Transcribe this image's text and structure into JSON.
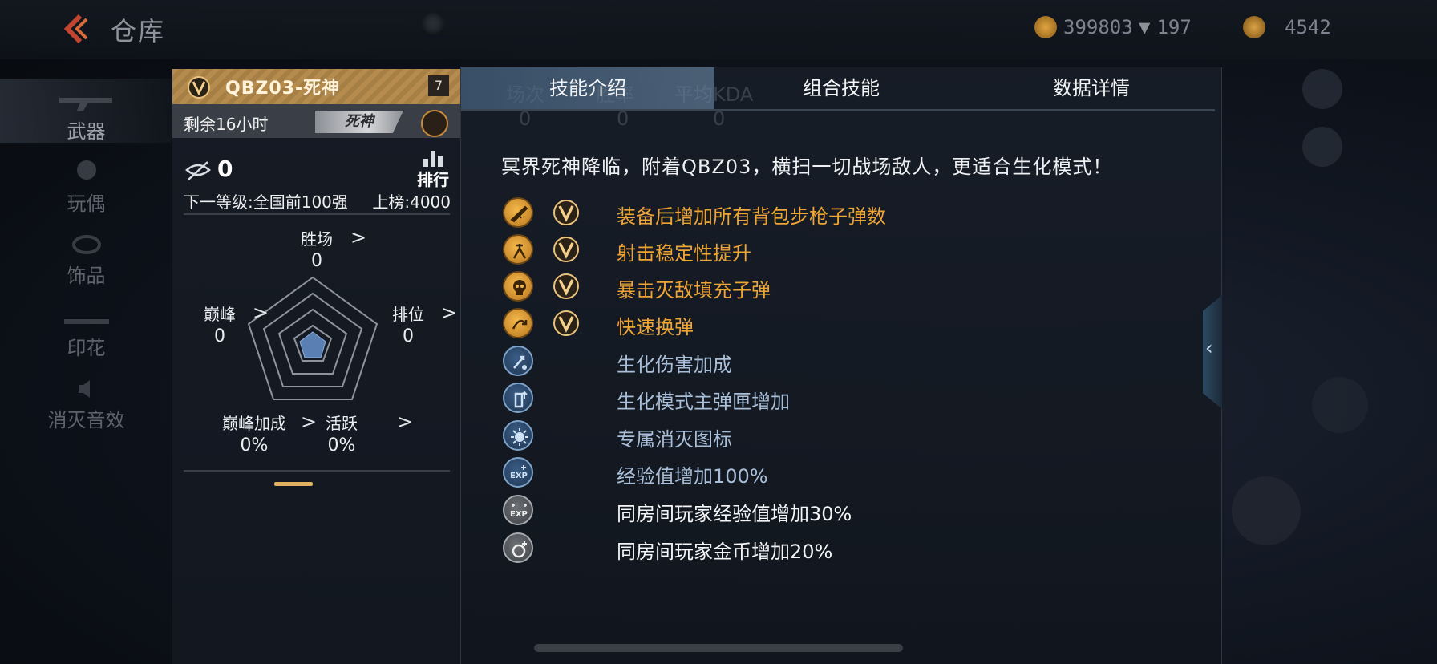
{
  "header": {
    "title": "仓库",
    "currencies": [
      {
        "icon": "gold-coin-icon",
        "value": "399803",
        "color": "#c58a2a"
      },
      {
        "icon": "diamond-icon",
        "value": "197",
        "color": "#8c8f95"
      },
      {
        "icon": "token-icon",
        "value": "4542",
        "color": "#b8862f"
      }
    ]
  },
  "sidebar": {
    "items": [
      {
        "label": "武器",
        "active": true
      },
      {
        "label": "玩偶",
        "active": false
      },
      {
        "label": "饰品",
        "active": false
      },
      {
        "label": "印花",
        "active": false
      },
      {
        "label": "消灭音效",
        "active": false
      }
    ]
  },
  "card": {
    "name": "QBZ03-死神",
    "level": "7",
    "remaining": "剩余16小时",
    "tag": "死神",
    "rank_value": "0",
    "rank_board_label": "排行",
    "next_level": "下一等级:全国前100强",
    "on_board": "上榜:4000",
    "radar": {
      "wins": {
        "label": "胜场",
        "value": "0"
      },
      "peak": {
        "label": "巅峰",
        "value": "0"
      },
      "ranked": {
        "label": "排位",
        "value": "0"
      },
      "peak_bonus": {
        "label": "巅峰加成",
        "value": "0%"
      },
      "active": {
        "label": "活跃",
        "value": "0%"
      }
    },
    "accent_color": "#b58c4e"
  },
  "panel": {
    "tabs": [
      {
        "label": "技能介绍",
        "active": true
      },
      {
        "label": "组合技能",
        "active": false
      },
      {
        "label": "数据详情",
        "active": false
      }
    ],
    "ghost_tabs": [
      "场次",
      "胜率",
      "平均KDA"
    ],
    "ghost_values": [
      "0",
      "0",
      "0"
    ],
    "description": "冥界死神降临，附着QBZ03，横扫一切战场敌人，更适合生化模式！",
    "skills": [
      {
        "text": "装备后增加所有背包步枪子弹数",
        "icon": "rifle-icon",
        "style": "gold",
        "badge": true
      },
      {
        "text": "射击稳定性提升",
        "icon": "stability-icon",
        "style": "gold",
        "badge": true
      },
      {
        "text": "暴击灭敌填充子弹",
        "icon": "skull-icon",
        "style": "gold",
        "badge": true
      },
      {
        "text": "快速换弹",
        "icon": "reload-icon",
        "style": "gold",
        "badge": true
      },
      {
        "text": "生化伤害加成",
        "icon": "damage-icon",
        "style": "blue",
        "badge": false
      },
      {
        "text": "生化模式主弹匣增加",
        "icon": "magazine-icon",
        "style": "blue",
        "badge": false
      },
      {
        "text": "专属消灭图标",
        "icon": "kill-mark-icon",
        "style": "blue",
        "badge": false
      },
      {
        "text": "经验值增加100%",
        "icon": "exp-icon",
        "style": "blue",
        "badge": false
      },
      {
        "text": "同房间玩家经验值增加30%",
        "icon": "team-exp-icon",
        "style": "white",
        "badge": false
      },
      {
        "text": "同房间玩家金币增加20%",
        "icon": "team-coin-icon",
        "style": "white",
        "badge": false
      }
    ],
    "gold_color": "#efa535",
    "blue_color": "#a9bfd9"
  }
}
